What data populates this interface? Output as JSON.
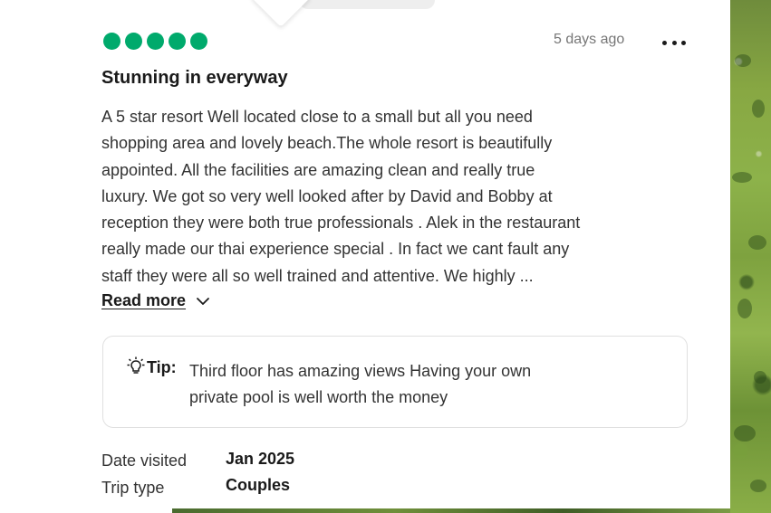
{
  "review": {
    "rating_value": 5,
    "rating_max": 5,
    "rating_color": "#00aa6c",
    "date_posted": "5 days ago",
    "more_icon": "ellipsis-icon",
    "title": "Stunning in everyway",
    "body": "A 5 star resort  Well located close to a small but all you need\nshopping area and lovely beach.The whole resort is beautifully\nappointed. All the facilities are amazing clean and really true\nluxury. We got so very well looked after by David and Bobby at\nreception they were both true professionals . Alek in the restaurant\nreally made our thai experience special . In fact we cant fault any\nstaff they were all so well trained and attentive. We highly ...",
    "read_more_label": "Read more",
    "read_more_icon": "chevron-down-icon",
    "tip": {
      "icon": "lightbulb-icon",
      "label": "Tip:",
      "text": "Third floor has amazing views Having your own\nprivate pool is well worth the money"
    },
    "meta": {
      "date_visited_label": "Date visited",
      "date_visited_value": "Jan 2025",
      "trip_type_label": "Trip type",
      "trip_type_value": "Couples"
    }
  }
}
